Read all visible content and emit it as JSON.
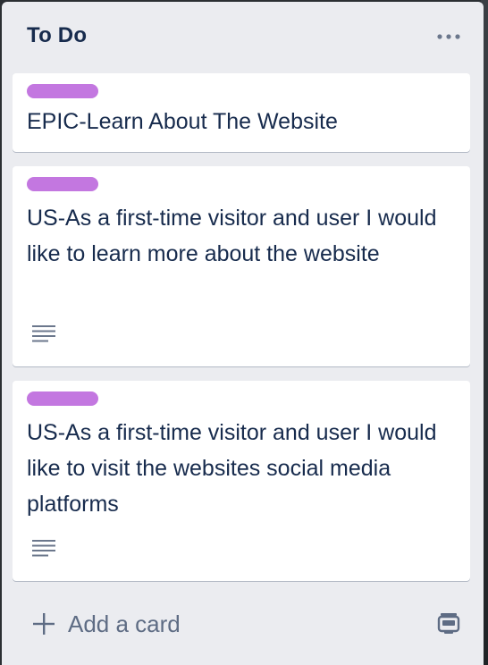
{
  "list": {
    "title": "To Do",
    "menu_icon": "ellipsis-icon"
  },
  "cards": [
    {
      "label_color": "#c377e0",
      "title": "EPIC-Learn About The Website",
      "has_description": false
    },
    {
      "label_color": "#c377e0",
      "title": "US-As a first-time visitor and user I would like to learn more about the website",
      "has_description": true
    },
    {
      "label_color": "#c377e0",
      "title": "US-As a first-time visitor and user I would like to visit the websites social media platforms",
      "has_description": true
    }
  ],
  "footer": {
    "add_card_label": "Add a card",
    "add_icon": "plus-icon",
    "template_icon": "card-template-icon"
  },
  "colors": {
    "list_bg": "#ebecf0",
    "text": "#172b4d",
    "muted": "#5e6c84"
  }
}
